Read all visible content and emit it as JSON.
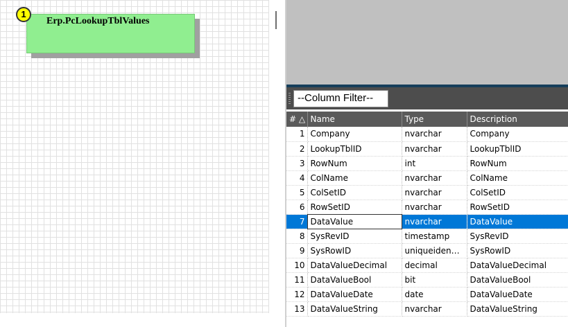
{
  "diagram": {
    "table_title": "Erp.PcLookupTblValues",
    "badge": "1"
  },
  "filter": {
    "placeholder": "--Column Filter--"
  },
  "grid": {
    "headers": {
      "num": "# △",
      "name": "Name",
      "type": "Type",
      "description": "Description"
    },
    "selected_row": 7,
    "rows": [
      {
        "num": "1",
        "name": "Company",
        "type": "nvarchar",
        "description": "Company"
      },
      {
        "num": "2",
        "name": "LookupTblID",
        "type": "nvarchar",
        "description": "LookupTblID"
      },
      {
        "num": "3",
        "name": "RowNum",
        "type": "int",
        "description": "RowNum"
      },
      {
        "num": "4",
        "name": "ColName",
        "type": "nvarchar",
        "description": "ColName"
      },
      {
        "num": "5",
        "name": "ColSetID",
        "type": "nvarchar",
        "description": "ColSetID"
      },
      {
        "num": "6",
        "name": "RowSetID",
        "type": "nvarchar",
        "description": "RowSetID"
      },
      {
        "num": "7",
        "name": "DataValue",
        "type": "nvarchar",
        "description": "DataValue"
      },
      {
        "num": "8",
        "name": "SysRevID",
        "type": "timestamp",
        "description": "SysRevID"
      },
      {
        "num": "9",
        "name": "SysRowID",
        "type": "uniqueiden…",
        "description": "SysRowID"
      },
      {
        "num": "10",
        "name": "DataValueDecimal",
        "type": "decimal",
        "description": "DataValueDecimal"
      },
      {
        "num": "11",
        "name": "DataValueBool",
        "type": "bit",
        "description": "DataValueBool"
      },
      {
        "num": "12",
        "name": "DataValueDate",
        "type": "date",
        "description": "DataValueDate"
      },
      {
        "num": "13",
        "name": "DataValueString",
        "type": "nvarchar",
        "description": "DataValueString"
      }
    ]
  },
  "colors": {
    "table_card": "#90ee90",
    "badge": "#ffff00",
    "selection": "#0078d7",
    "header": "#5a5a5a"
  }
}
